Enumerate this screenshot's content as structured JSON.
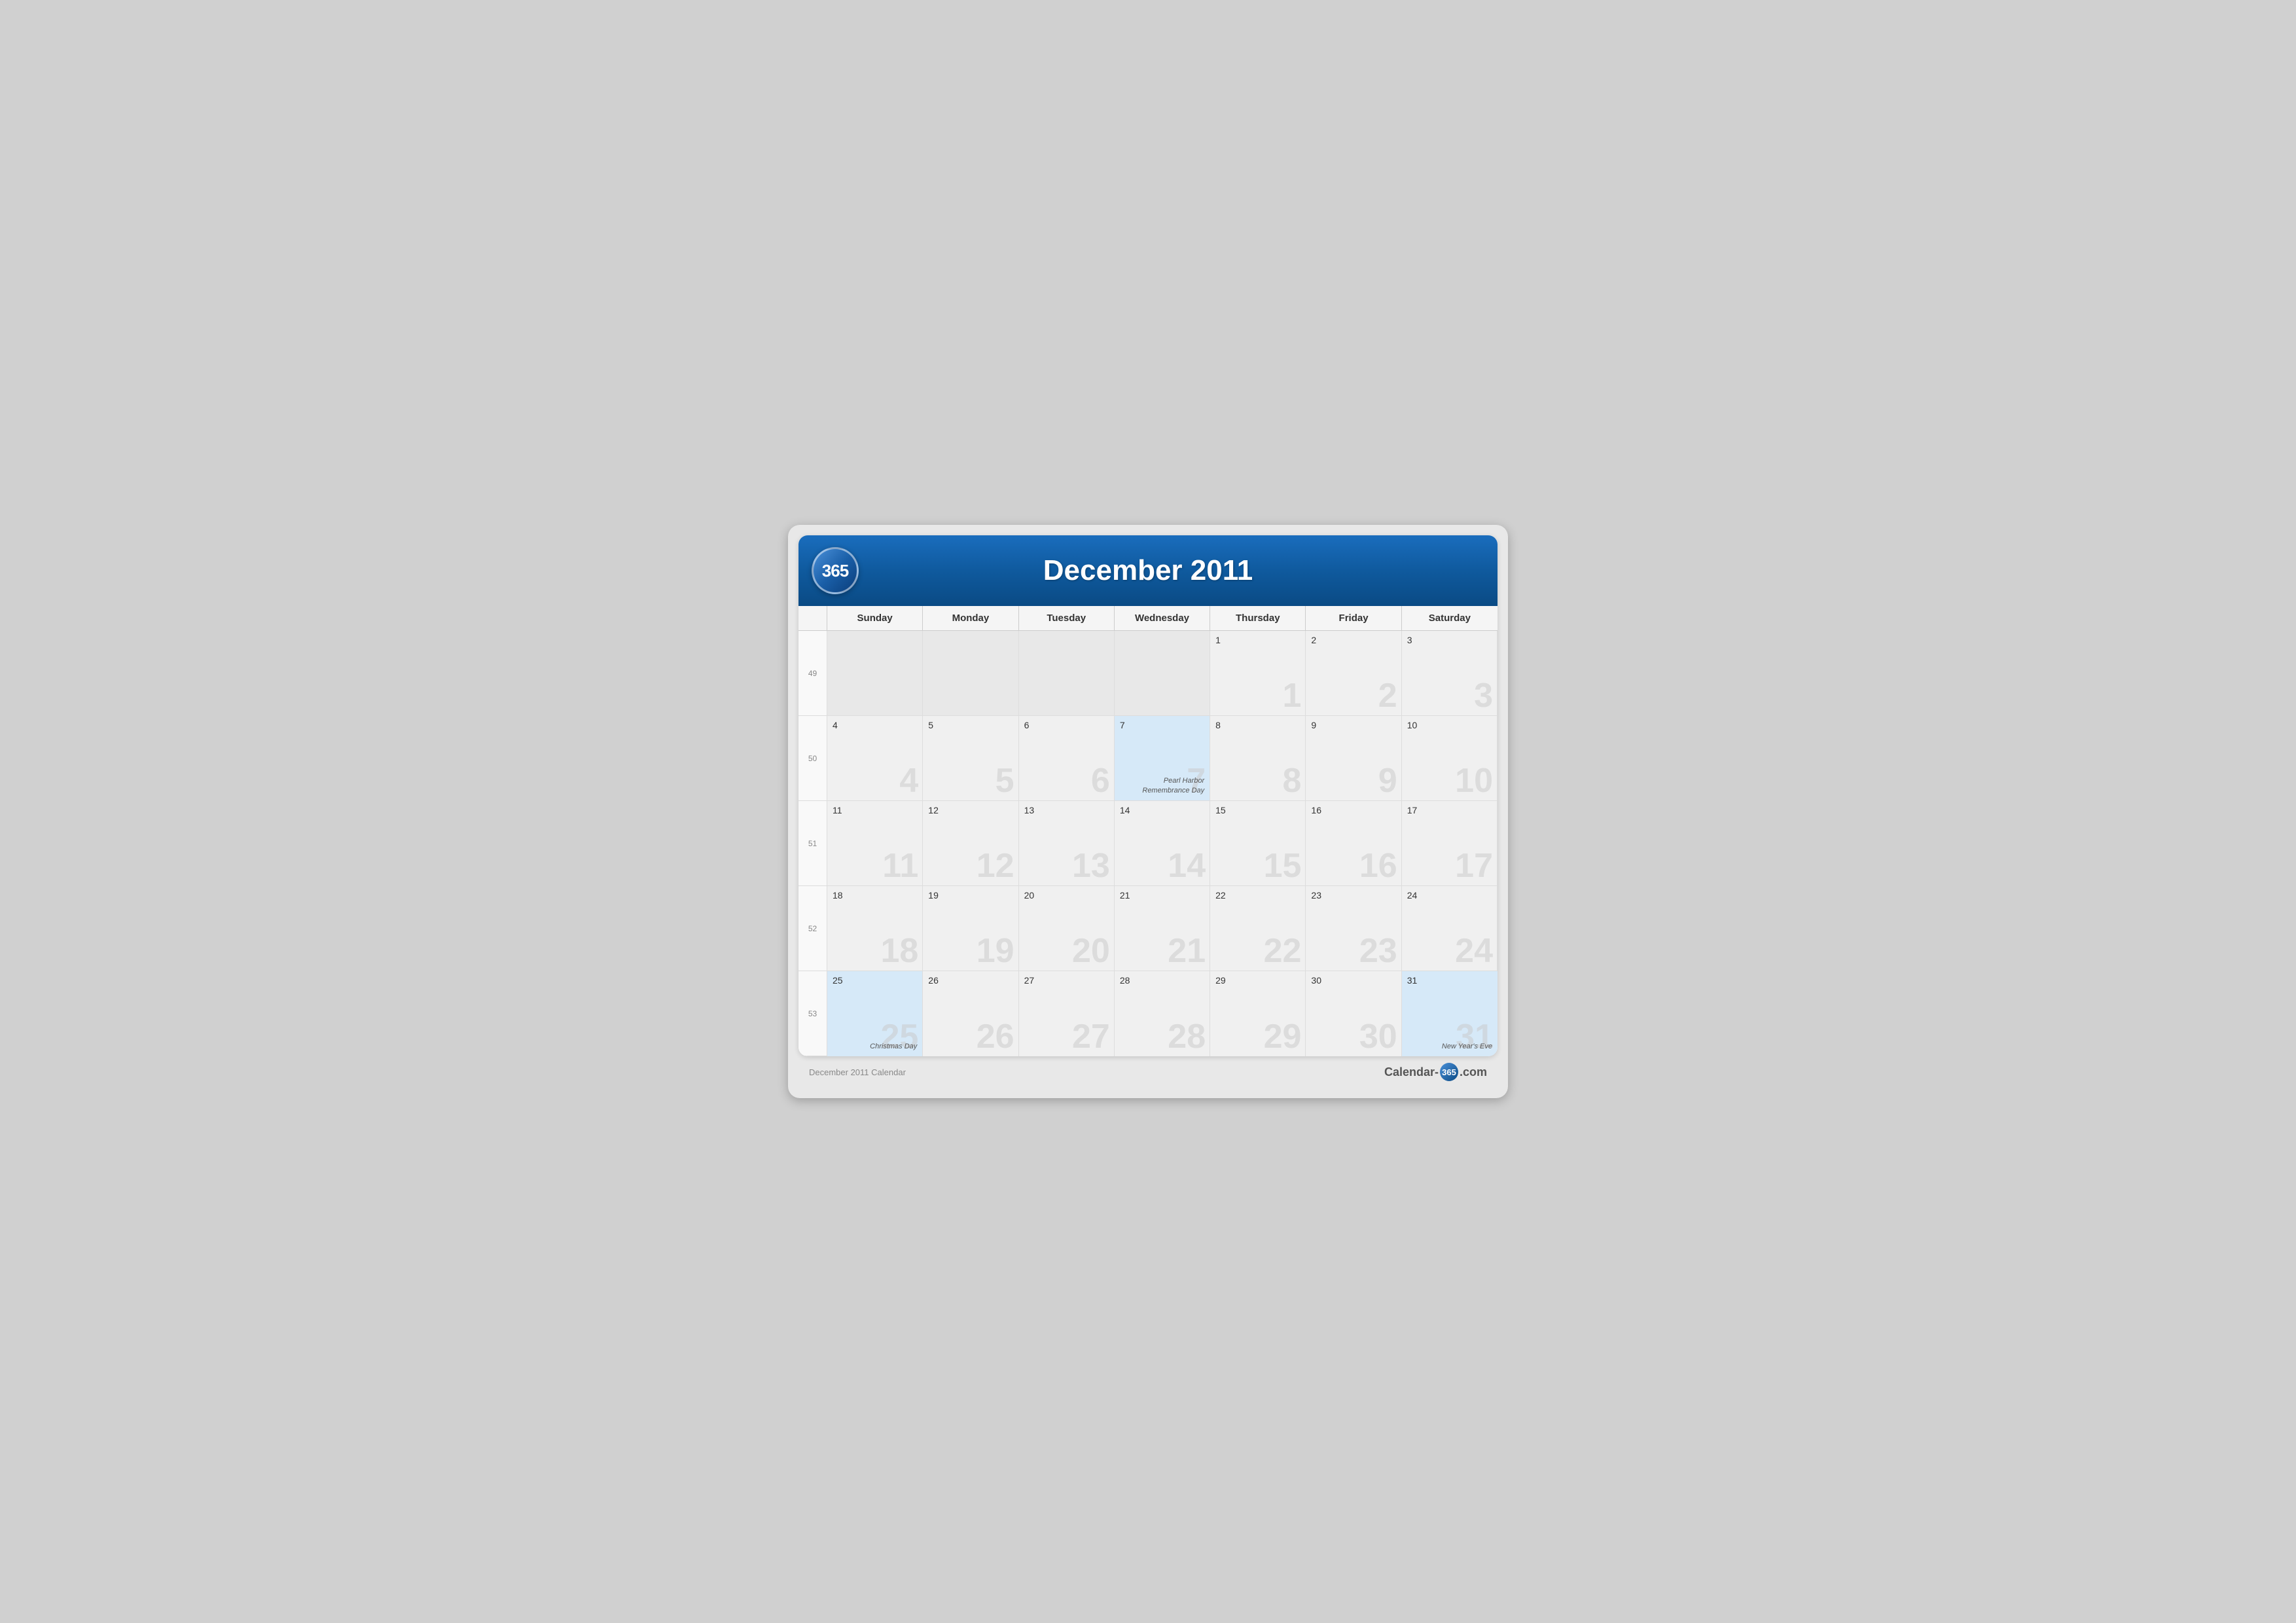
{
  "header": {
    "logo": "365",
    "title": "December 2011"
  },
  "day_headers": [
    "Sunday",
    "Monday",
    "Tuesday",
    "Wednesday",
    "Thursday",
    "Friday",
    "Saturday"
  ],
  "weeks": [
    {
      "week_num": "49",
      "days": [
        {
          "date": "",
          "empty": true
        },
        {
          "date": "",
          "empty": true
        },
        {
          "date": "",
          "empty": true
        },
        {
          "date": "",
          "empty": true
        },
        {
          "date": "1",
          "highlight": false
        },
        {
          "date": "2",
          "highlight": false
        },
        {
          "date": "3",
          "highlight": false
        }
      ]
    },
    {
      "week_num": "50",
      "days": [
        {
          "date": "4",
          "highlight": false
        },
        {
          "date": "5",
          "highlight": false
        },
        {
          "date": "6",
          "highlight": false
        },
        {
          "date": "7",
          "highlight": true,
          "event": "Pearl Harbor Remembrance Day"
        },
        {
          "date": "8",
          "highlight": false
        },
        {
          "date": "9",
          "highlight": false
        },
        {
          "date": "10",
          "highlight": false
        }
      ]
    },
    {
      "week_num": "51",
      "days": [
        {
          "date": "11",
          "highlight": false
        },
        {
          "date": "12",
          "highlight": false
        },
        {
          "date": "13",
          "highlight": false
        },
        {
          "date": "14",
          "highlight": false
        },
        {
          "date": "15",
          "highlight": false
        },
        {
          "date": "16",
          "highlight": false
        },
        {
          "date": "17",
          "highlight": false
        }
      ]
    },
    {
      "week_num": "52",
      "days": [
        {
          "date": "18",
          "highlight": false
        },
        {
          "date": "19",
          "highlight": false
        },
        {
          "date": "20",
          "highlight": false
        },
        {
          "date": "21",
          "highlight": false
        },
        {
          "date": "22",
          "highlight": false
        },
        {
          "date": "23",
          "highlight": false
        },
        {
          "date": "24",
          "highlight": false
        }
      ]
    },
    {
      "week_num": "53",
      "days": [
        {
          "date": "25",
          "highlight": true,
          "event": "Christmas Day"
        },
        {
          "date": "26",
          "highlight": false
        },
        {
          "date": "27",
          "highlight": false
        },
        {
          "date": "28",
          "highlight": false
        },
        {
          "date": "29",
          "highlight": false
        },
        {
          "date": "30",
          "highlight": false
        },
        {
          "date": "31",
          "highlight": true,
          "event": "New Year's Eve"
        }
      ]
    }
  ],
  "footer": {
    "copyright": "December 2011 Calendar",
    "brand_text": "Calendar-",
    "brand_num": "365",
    "brand_suffix": ".com"
  }
}
